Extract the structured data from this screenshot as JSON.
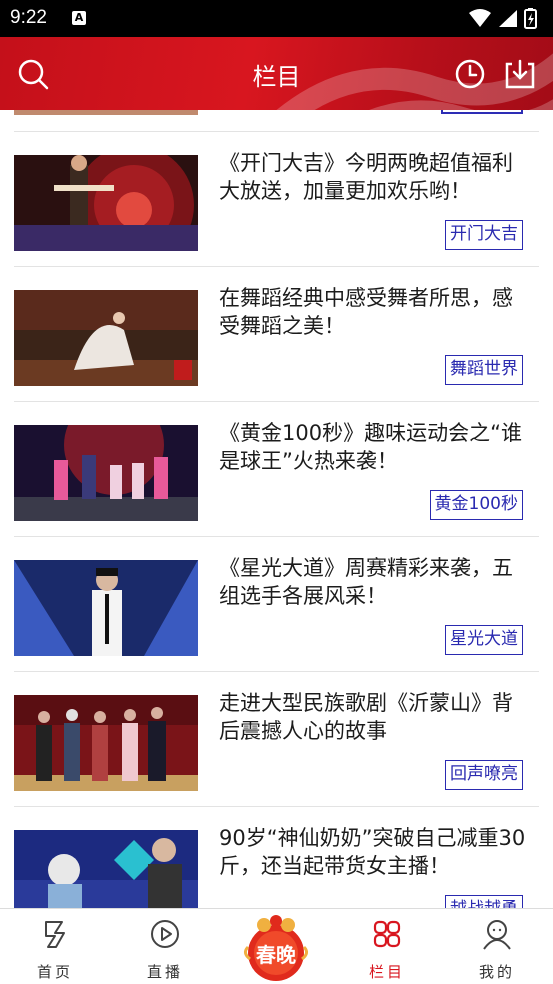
{
  "status": {
    "time": "9:22",
    "notif_letter": "A"
  },
  "header": {
    "title": "栏目"
  },
  "items": [
    {
      "title": "《开门大吉》今明两晚超值福利大放送，加量更加欢乐哟！",
      "tag": "开门大吉"
    },
    {
      "title": "在舞蹈经典中感受舞者所思，感受舞蹈之美！",
      "tag": "舞蹈世界"
    },
    {
      "title": "《黄金100秒》趣味运动会之“谁是球王”火热来袭！",
      "tag": "黄金100秒"
    },
    {
      "title": "《星光大道》周赛精彩来袭，五组选手各展风采！",
      "tag": "星光大道"
    },
    {
      "title": "走进大型民族歌剧《沂蒙山》背后震撼人心的故事",
      "tag": "回声嘹亮"
    },
    {
      "title": "90岁“神仙奶奶”突破自己减重30斤，还当起带货女主播！",
      "tag": "越战越勇"
    }
  ],
  "tabbar": {
    "home": "首页",
    "live": "直播",
    "center": "春晚",
    "columns": "栏目",
    "me": "我的"
  },
  "colors": {
    "accent": "#d8161f",
    "tag_border": "#2a2ab0"
  }
}
